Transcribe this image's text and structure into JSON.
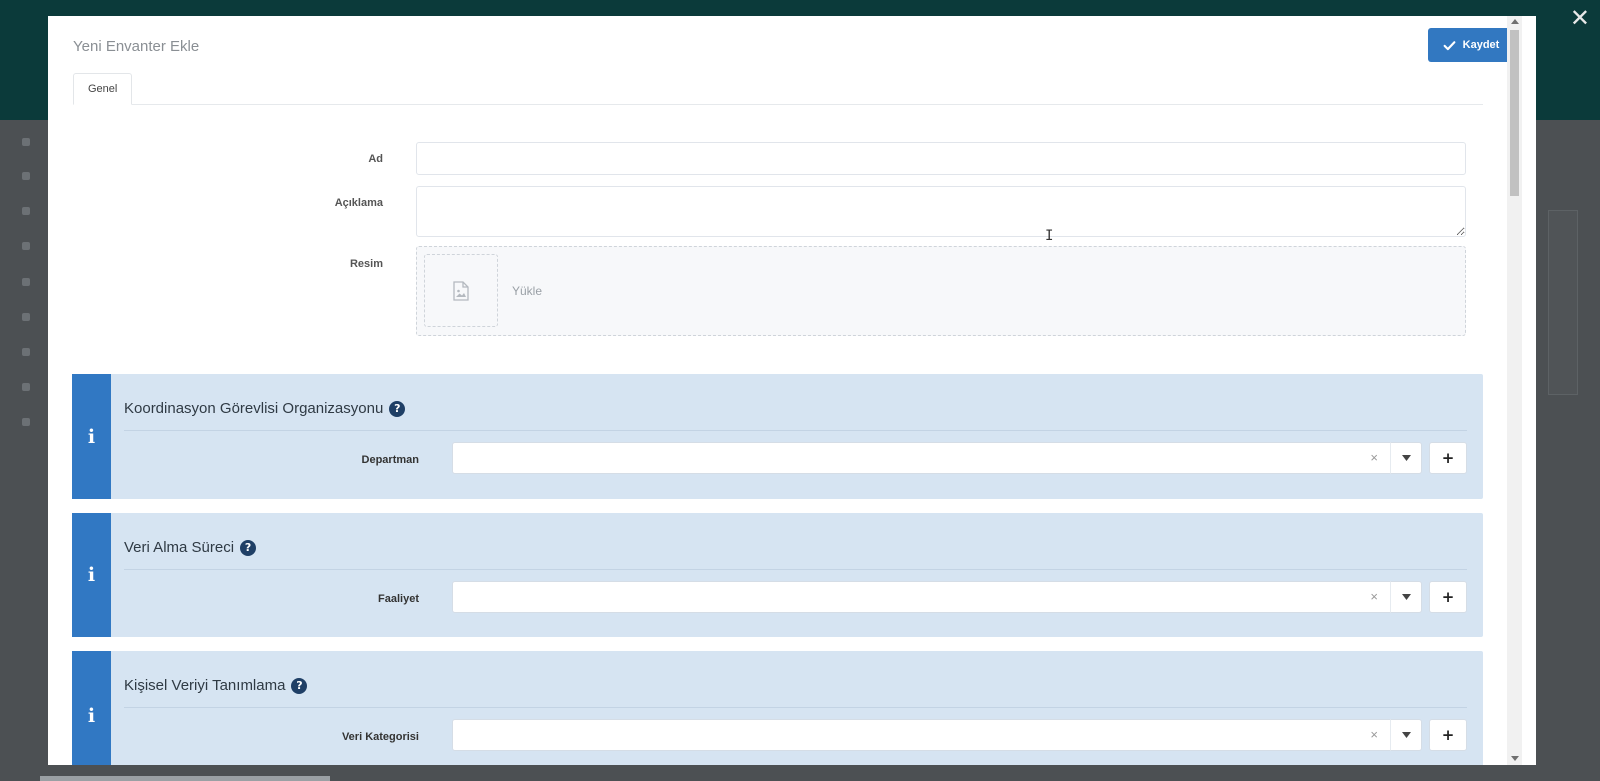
{
  "modal": {
    "title": "Yeni Envanter Ekle",
    "save_label": "Kaydet",
    "tabs": [
      {
        "label": "Genel",
        "active": true
      }
    ]
  },
  "form": {
    "ad_label": "Ad",
    "ad_value": "",
    "aciklama_label": "Açıklama",
    "aciklama_value": "",
    "resim_label": "Resim",
    "upload_label": "Yükle"
  },
  "panels": [
    {
      "title": "Koordinasyon Görevlisi Organizasyonu",
      "field_label": "Departman",
      "value": ""
    },
    {
      "title": "Veri Alma Süreci",
      "field_label": "Faaliyet",
      "value": ""
    },
    {
      "title": "Kişisel Veriyi Tanımlama",
      "field_label": "Veri Kategorisi",
      "value": ""
    }
  ],
  "icons": {
    "info": "i",
    "help": "?",
    "clear": "×",
    "plus": "+",
    "close": "✕"
  },
  "colors": {
    "accent": "#3278c1",
    "panel_bg": "#d6e4f2",
    "help_icon": "#1f3f66"
  }
}
